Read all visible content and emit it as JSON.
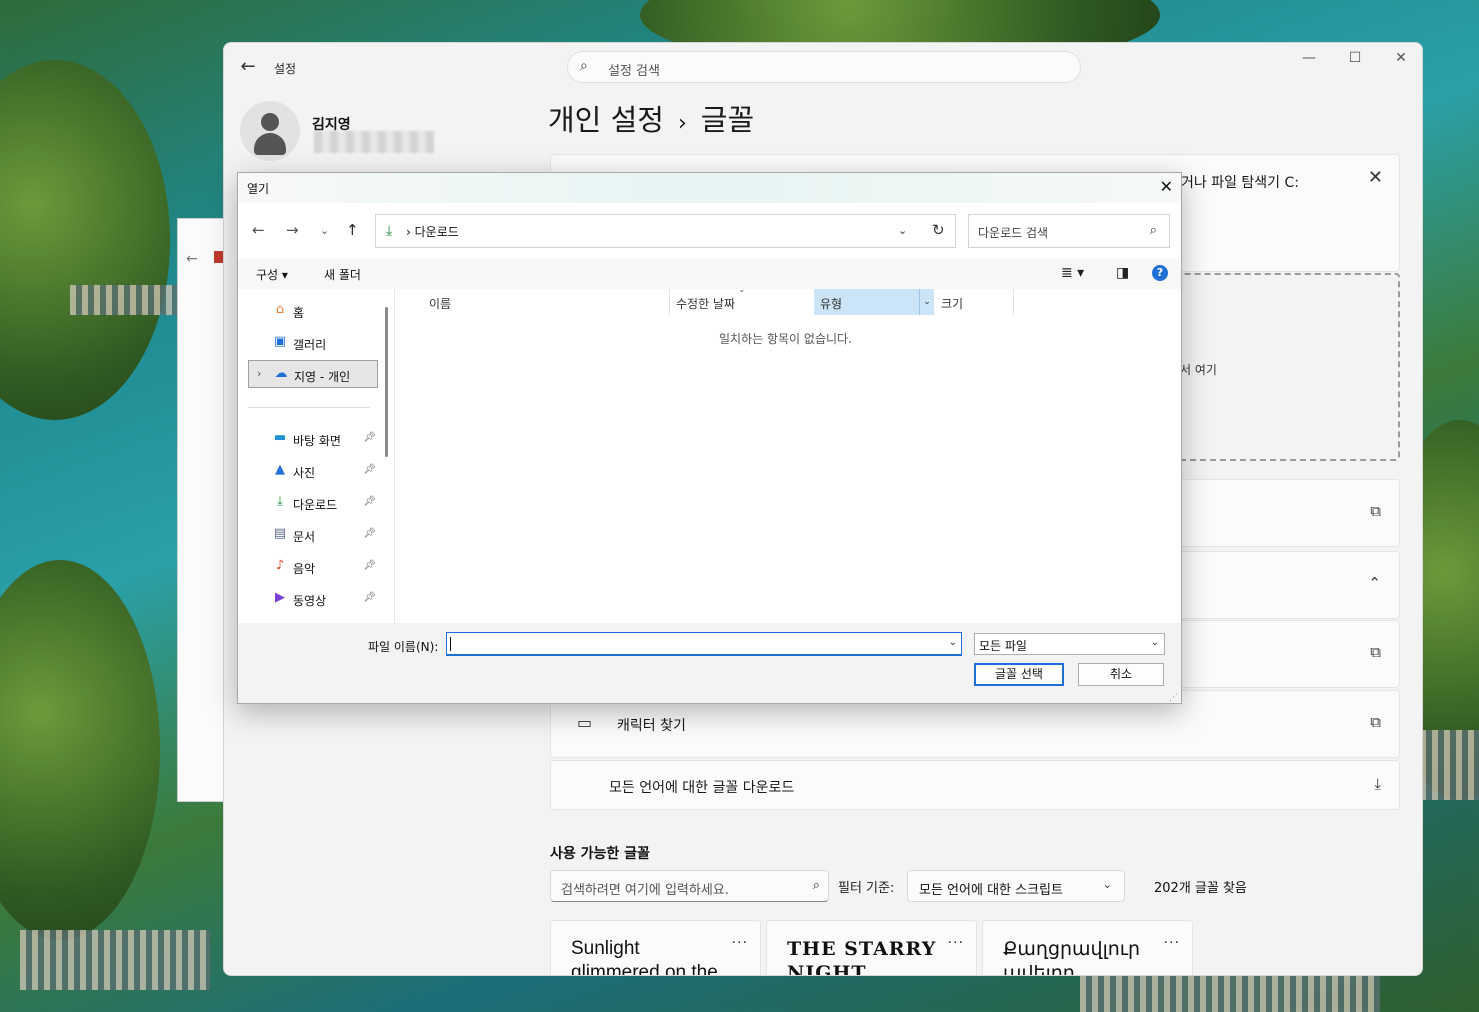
{
  "settings": {
    "app_title": "설정",
    "search_placeholder": "설정 검색",
    "user_name": "김지영",
    "breadcrumb_parent": "개인 설정",
    "breadcrumb_sep": "›",
    "breadcrumb_current": "글꼴",
    "info_tail": "거나 파일 탐색기 C:",
    "drop_tail": "서 여기",
    "rows": {
      "char_finder": "캐릭터 찾기",
      "download_fonts": "모든 언어에 대한 글꼴 다운로드"
    },
    "available_title": "사용 가능한 글꼴",
    "font_search_placeholder": "검색하려면 여기에 입력하세요.",
    "filter_label": "필터 기준:",
    "filter_value": "모든 언어에 대한 스크립트",
    "font_count": "202개 글꼴 찾음",
    "font_cards": [
      {
        "sample": "Sunlight glimmered on the snowfall",
        "more": "···"
      },
      {
        "sample": "THE STARRY NIGHT",
        "more": "···"
      },
      {
        "sample": "Քաղցրավլուր ավելոր",
        "more": "···"
      }
    ]
  },
  "dialog": {
    "title": "열기",
    "address_crumb": "다운로드",
    "search_placeholder": "다운로드 검색",
    "organize": "구성",
    "new_folder": "새 폴더",
    "nav": {
      "home": "홈",
      "gallery": "갤러리",
      "onedrive": "지영 - 개인",
      "desktop": "바탕 화면",
      "pictures": "사진",
      "downloads": "다운로드",
      "documents": "문서",
      "music": "음악",
      "videos": "동영상"
    },
    "columns": {
      "name": "이름",
      "modified": "수정한 날짜",
      "type": "유형",
      "size": "크기"
    },
    "empty_message": "일치하는 항목이 없습니다.",
    "filename_label": "파일 이름(N):",
    "filename_value": "",
    "filetype_value": "모든 파일",
    "select_button": "글꼴 선택",
    "cancel_button": "취소"
  },
  "colors": {
    "accent": "#1f6fd6",
    "selected_header": "#cce4f7",
    "downloads_green": "#1e8a3a"
  }
}
